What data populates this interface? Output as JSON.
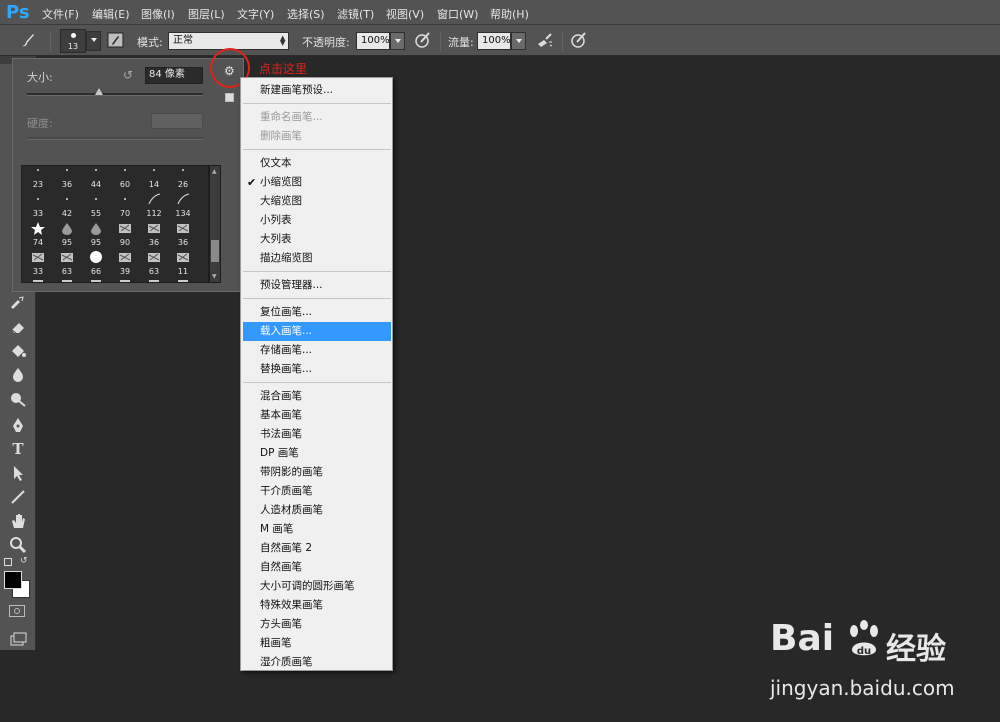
{
  "app": {
    "logo": "Ps"
  },
  "menubar": {
    "items": [
      "文件(F)",
      "编辑(E)",
      "图像(I)",
      "图层(L)",
      "文字(Y)",
      "选择(S)",
      "滤镜(T)",
      "视图(V)",
      "窗口(W)",
      "帮助(H)"
    ]
  },
  "options": {
    "brush_size_badge": "13",
    "mode_label": "模式:",
    "mode_value": "正常",
    "opacity_label": "不透明度:",
    "opacity_value": "100%",
    "flow_label": "流量:",
    "flow_value": "100%"
  },
  "brush_panel": {
    "size_label": "大小:",
    "size_value": "84 像素",
    "size_slider_fraction": 0.41,
    "hardness_label": "硬度:",
    "thumbnails": [
      [
        "23",
        "36",
        "44",
        "60",
        "14",
        "26"
      ],
      [
        "33",
        "42",
        "55",
        "70",
        "112",
        "134"
      ],
      [
        "74",
        "95",
        "95",
        "90",
        "36",
        "36"
      ],
      [
        "33",
        "63",
        "66",
        "39",
        "63",
        "11"
      ]
    ]
  },
  "annotation": {
    "text": "点击这里",
    "color": "#e2231a"
  },
  "flyout": {
    "groups": [
      [
        {
          "label": "新建画笔预设..."
        }
      ],
      [
        {
          "label": "重命名画笔...",
          "disabled": true
        },
        {
          "label": "删除画笔",
          "disabled": true
        }
      ],
      [
        {
          "label": "仅文本"
        },
        {
          "label": "小缩览图",
          "checked": true
        },
        {
          "label": "大缩览图"
        },
        {
          "label": "小列表"
        },
        {
          "label": "大列表"
        },
        {
          "label": "描边缩览图"
        }
      ],
      [
        {
          "label": "预设管理器..."
        }
      ],
      [
        {
          "label": "复位画笔..."
        },
        {
          "label": "载入画笔...",
          "selected": true
        },
        {
          "label": "存储画笔..."
        },
        {
          "label": "替换画笔..."
        }
      ],
      [
        {
          "label": "混合画笔"
        },
        {
          "label": "基本画笔"
        },
        {
          "label": "书法画笔"
        },
        {
          "label": "DP 画笔"
        },
        {
          "label": "带阴影的画笔"
        },
        {
          "label": "干介质画笔"
        },
        {
          "label": "人造材质画笔"
        },
        {
          "label": "M 画笔"
        },
        {
          "label": "自然画笔 2"
        },
        {
          "label": "自然画笔"
        },
        {
          "label": "大小可调的圆形画笔"
        },
        {
          "label": "特殊效果画笔"
        },
        {
          "label": "方头画笔"
        },
        {
          "label": "粗画笔"
        },
        {
          "label": "湿介质画笔"
        }
      ]
    ],
    "highlight_color": "#3399ff"
  },
  "watermark": {
    "brand_main": "Bai",
    "brand_tail": "经验",
    "url": "jingyan.baidu.com"
  }
}
